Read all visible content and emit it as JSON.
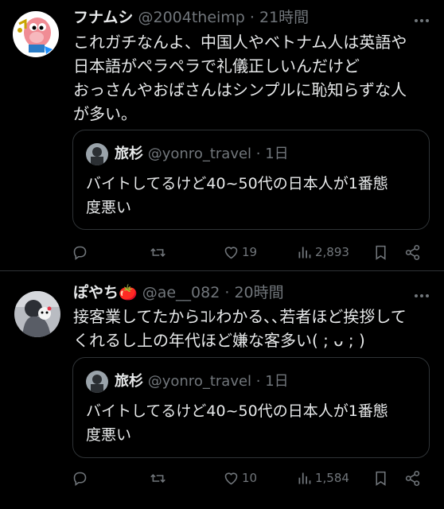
{
  "tweets": [
    {
      "name": "フナムシ",
      "handle": "@2004theimp",
      "time": "· 21時間",
      "text": "これガチなんよ、中国人やベトナム人は英語や\n日本語がペラペラで礼儀正しいんだけど\nおっさんやおばさんはシンプルに恥知らずな人\nが多い。",
      "quote": {
        "name": "旅杉",
        "handle": "@yonro_travel",
        "time": "· 1日",
        "text": "バイトしてるけど40~50代の日本人が1番態\n度悪い"
      },
      "likes": "19",
      "views": "2,893"
    },
    {
      "name": "ぽやち🍅",
      "handle": "@ae__082",
      "time": "· 20時間",
      "text": "接客業してたからｺﾚわかる､､若者ほど挨拶して\nくれるし上の年代ほど嫌な客多い( ; ᴗ ; )",
      "quote": {
        "name": "旅杉",
        "handle": "@yonro_travel",
        "time": "· 1日",
        "text": "バイトしてるけど40~50代の日本人が1番態\n度悪い"
      },
      "likes": "10",
      "views": "1,584"
    }
  ],
  "icons": [
    "more-icon",
    "reply-icon",
    "retweet-icon",
    "like-icon",
    "views-icon",
    "bookmark-icon",
    "share-icon"
  ],
  "colors": {
    "background": "#000000",
    "text": "#e7e9ea",
    "secondary": "#71767b",
    "border": "#2f3336"
  }
}
